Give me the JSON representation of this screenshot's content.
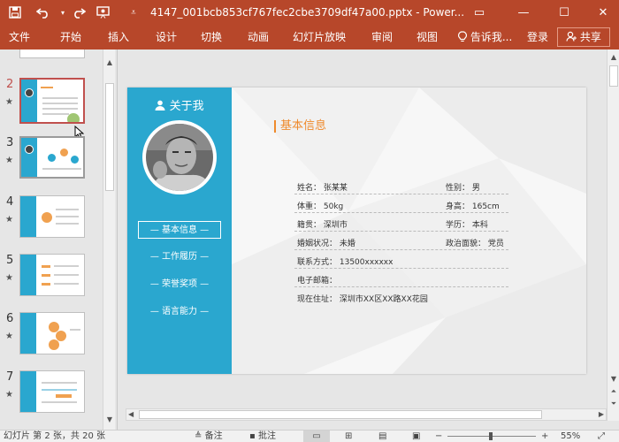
{
  "titlebar": {
    "title": "4147_001bcb853cf767fec2cbe3709df47a00.pptx - Power...",
    "icons": [
      "save-icon",
      "undo-icon",
      "redo-icon",
      "present-from-start-icon",
      "customize-toolbar-icon"
    ],
    "ribbon_display": "▭",
    "minimize": "—",
    "maximize": "☐",
    "close": "✕"
  },
  "ribbon": {
    "tabs": [
      "文件",
      "开始",
      "插入",
      "设计",
      "切换",
      "动画",
      "幻灯片放映",
      "审阅",
      "视图"
    ],
    "tell_me": "告诉我...",
    "login": "登录",
    "share": "共享"
  },
  "thumbnails": [
    {
      "number": "2",
      "star": "★"
    },
    {
      "number": "3",
      "star": "★"
    },
    {
      "number": "4",
      "star": "★"
    },
    {
      "number": "5",
      "star": "★"
    },
    {
      "number": "6",
      "star": "★"
    },
    {
      "number": "7",
      "star": "★"
    }
  ],
  "slide": {
    "about_title": "关于我",
    "menu": [
      "— 基本信息 —",
      "— 工作履历 —",
      "— 荣誉奖项 —",
      "— 语言能力 —"
    ],
    "section_title": "基本信息",
    "info": {
      "name": "姓名：  张某某",
      "gender": "性别：  男",
      "weight": "体重：  50kg",
      "height": "身高：  165cm",
      "origin": "籍贯：  深圳市",
      "education": "学历：  本科",
      "marital": "婚姻状况：  未婚",
      "political": "政治面貌：  党员",
      "contact": "联系方式：  13500xxxxxx",
      "email": "电子邮箱：",
      "address": "现在住址：  深圳市XX区XX路XX花园"
    }
  },
  "statusbar": {
    "slide_info": "幻灯片 第 2 张，共 20 张",
    "notes": "备注",
    "comments": "批注",
    "zoom": "55%"
  },
  "colors": {
    "accent": "#b7472a",
    "sidebar": "#2aa7cf",
    "section": "#ef8a2c"
  }
}
